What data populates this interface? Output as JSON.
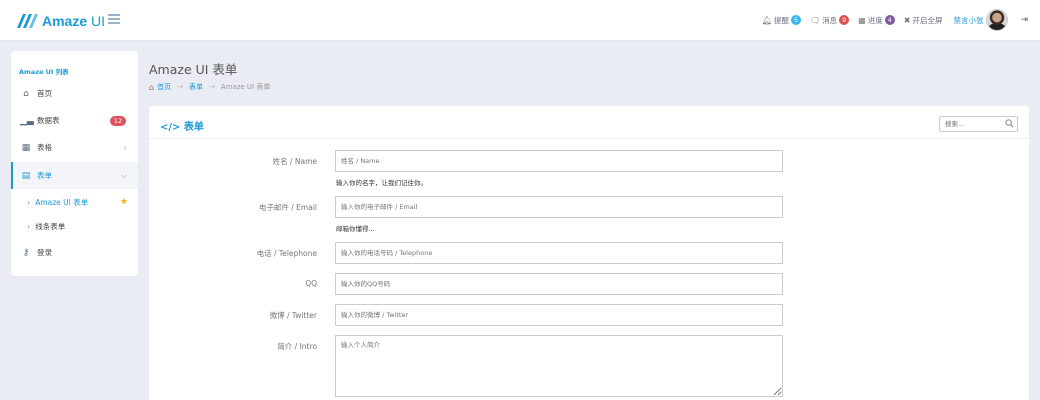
{
  "header": {
    "logo_bold": "Amaze",
    "logo_rest": " UI",
    "items": [
      {
        "label": "提醒",
        "badge": "5",
        "badge_color": "#3bb4f2"
      },
      {
        "label": "消息",
        "badge": "9",
        "badge_color": "#dd514c"
      },
      {
        "label": "进度",
        "badge": "4",
        "badge_color": "#8058a5"
      }
    ],
    "fullscreen": "开启全屏",
    "user_name": "禁言小张"
  },
  "sidebar": {
    "title": "Amaze UI 列表",
    "items": [
      {
        "label": "首页",
        "icon": "home-icon"
      },
      {
        "label": "数据表",
        "icon": "bar-chart-icon",
        "badge": "12"
      },
      {
        "label": "表格",
        "icon": "table-icon"
      },
      {
        "label": "表单",
        "icon": "form-icon"
      },
      {
        "label": "登录",
        "icon": "key-icon"
      }
    ],
    "subitems": [
      {
        "label": "Amaze UI 表单"
      },
      {
        "label": "线条表单"
      }
    ]
  },
  "page": {
    "title": "Amaze UI 表单",
    "breadcrumb": [
      "首页",
      "表单",
      "Amaze UI 表单"
    ]
  },
  "panel": {
    "title": "表单",
    "search_placeholder": "搜索..."
  },
  "form": {
    "fields": [
      {
        "label": "姓名 / Name",
        "placeholder": "姓名 / Name",
        "help": "输入你的名字，让我们记住你。"
      },
      {
        "label": "电子邮件 / Email",
        "placeholder": "输入你的电子邮件 / Email",
        "help": "邮箱你懂得..."
      },
      {
        "label": "电话 / Telephone",
        "placeholder": "输入你的电话号码 / Telephone"
      },
      {
        "label": "QQ",
        "placeholder": "输入你的QQ号码"
      },
      {
        "label": "微博 / Twitter",
        "placeholder": "输入你的微博 / Twitter"
      },
      {
        "label": "简介 / Intro",
        "placeholder": "输入个人简介"
      }
    ]
  },
  "colors": {
    "accent": "#1d9ad6",
    "background": "#e9ecf3",
    "danger_badge": "#e0525d",
    "star": "#f2b21a"
  }
}
